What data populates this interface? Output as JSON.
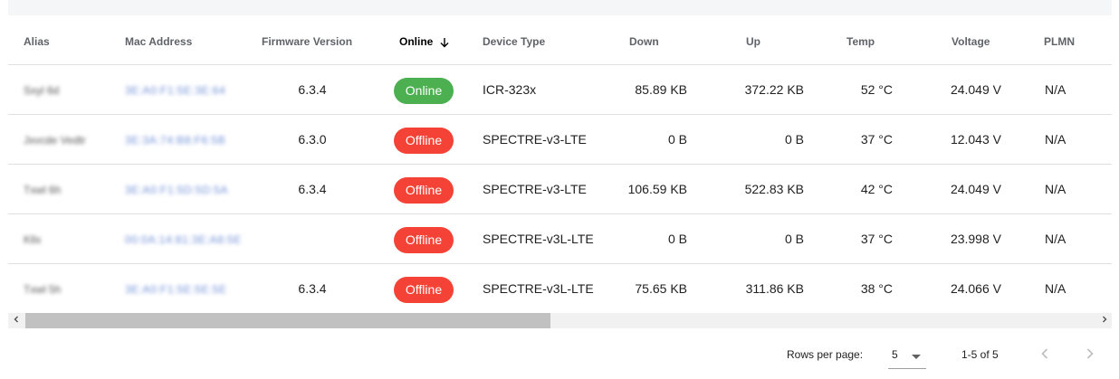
{
  "table": {
    "columns": [
      {
        "key": "alias",
        "label": "Alias"
      },
      {
        "key": "mac",
        "label": "Mac Address"
      },
      {
        "key": "firmware",
        "label": "Firmware Version"
      },
      {
        "key": "online",
        "label": "Online",
        "sorted": "descending"
      },
      {
        "key": "device_type",
        "label": "Device Type"
      },
      {
        "key": "down",
        "label": "Down"
      },
      {
        "key": "up",
        "label": "Up"
      },
      {
        "key": "temp",
        "label": "Temp"
      },
      {
        "key": "voltage",
        "label": "Voltage"
      },
      {
        "key": "plmn",
        "label": "PLMN"
      }
    ],
    "rows": [
      {
        "alias": "Sxyl 6d",
        "mac": "3E:A0:F1:5E:3E:64",
        "firmware": "6.3.4",
        "status": "Online",
        "device_type": "ICR-323x",
        "down": "85.89 KB",
        "up": "372.22 KB",
        "temp": "52 °C",
        "voltage": "24.049 V",
        "plmn": "N/A"
      },
      {
        "alias": "Jxvcde Vedtr",
        "mac": "3E:3A:74:B8:F6:5B",
        "firmware": "6.3.0",
        "status": "Offline",
        "device_type": "SPECTRE-v3-LTE",
        "down": "0 B",
        "up": "0 B",
        "temp": "37 °C",
        "voltage": "12.043 V",
        "plmn": "N/A"
      },
      {
        "alias": "Txwl 6h",
        "mac": "3E:A0:F1:5D:5D:5A",
        "firmware": "6.3.4",
        "status": "Offline",
        "device_type": "SPECTRE-v3-LTE",
        "down": "106.59 KB",
        "up": "522.83 KB",
        "temp": "42 °C",
        "voltage": "24.049 V",
        "plmn": "N/A"
      },
      {
        "alias": "Kllx",
        "mac": "00:0A:14:81:3E:A8:5E",
        "firmware": "",
        "status": "Offline",
        "device_type": "SPECTRE-v3L-LTE",
        "down": "0 B",
        "up": "0 B",
        "temp": "37 °C",
        "voltage": "23.998 V",
        "plmn": "N/A"
      },
      {
        "alias": "Txwl 5h",
        "mac": "3E:A0:F1:5E:5E:5E",
        "firmware": "6.3.4",
        "status": "Offline",
        "device_type": "SPECTRE-v3L-LTE",
        "down": "75.65 KB",
        "up": "311.86 KB",
        "temp": "38 °C",
        "voltage": "24.066 V",
        "plmn": "N/A"
      }
    ]
  },
  "scrollbar": {
    "left_icon": "chevron-left-icon",
    "right_icon": "chevron-right-icon"
  },
  "pagination": {
    "rows_per_page_label": "Rows per page:",
    "rows_per_page_value": "5",
    "range": "1-5 of 5",
    "prev_icon": "chevron-left-icon",
    "next_icon": "chevron-right-icon"
  },
  "colors": {
    "online": "#4caf50",
    "offline": "#f44336",
    "link": "#6f8fd6"
  }
}
